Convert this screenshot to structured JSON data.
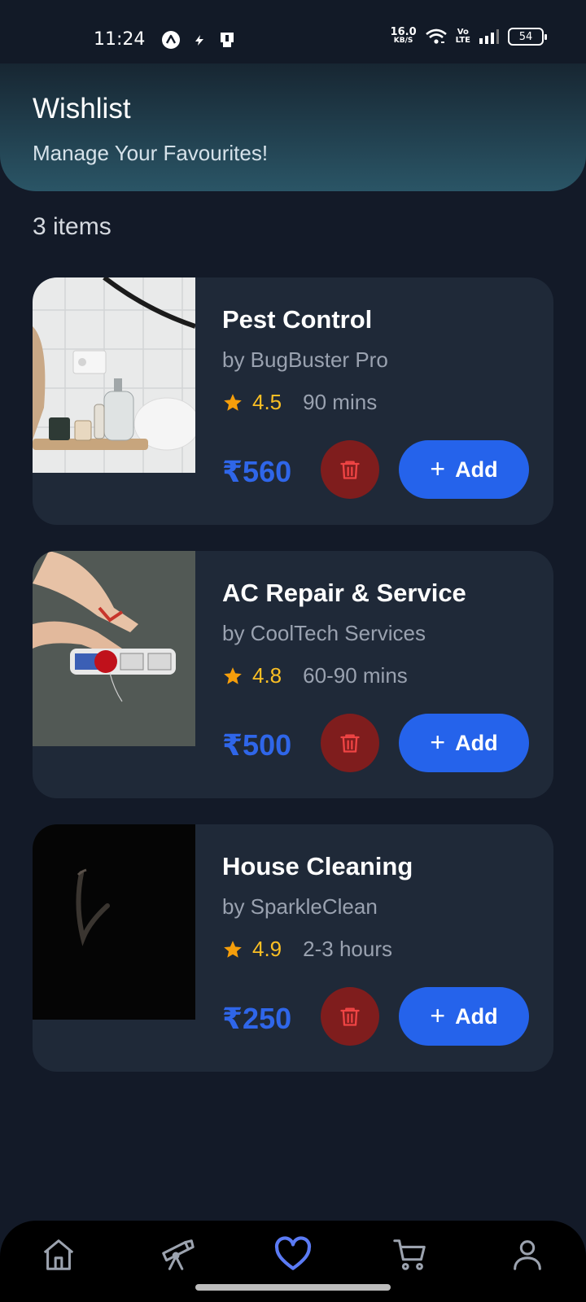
{
  "status_bar": {
    "time": "11:24",
    "net_speed_value": "16.0",
    "net_speed_unit": "KB/S",
    "lte_top": "Vo",
    "lte_bottom": "LTE",
    "battery": "54"
  },
  "header": {
    "title": "Wishlist",
    "subtitle": "Manage Your Favourites!"
  },
  "item_count": "3 items",
  "items": [
    {
      "name": "Pest Control",
      "provider": "by BugBuster Pro",
      "rating": "4.5",
      "duration": "90 mins",
      "price": "₹560",
      "add_label": "Add"
    },
    {
      "name": "AC Repair & Service",
      "provider": "by CoolTech Services",
      "rating": "4.8",
      "duration": "60-90 mins",
      "price": "₹500",
      "add_label": "Add"
    },
    {
      "name": "House Cleaning",
      "provider": "by SparkleClean",
      "rating": "4.9",
      "duration": "2-3 hours",
      "price": "₹250",
      "add_label": "Add"
    }
  ],
  "nav": {
    "items": [
      "home-icon",
      "telescope-icon",
      "heart-icon",
      "cart-icon",
      "profile-icon"
    ],
    "active": "heart-icon"
  },
  "colors": {
    "background": "#131a28",
    "card": "#1f2938",
    "accent_blue": "#2563eb",
    "price_blue": "#2f66e9",
    "delete_red": "#7f1d1d",
    "rating_yellow": "#fbbf24",
    "nav_active": "#5b7bf5"
  }
}
